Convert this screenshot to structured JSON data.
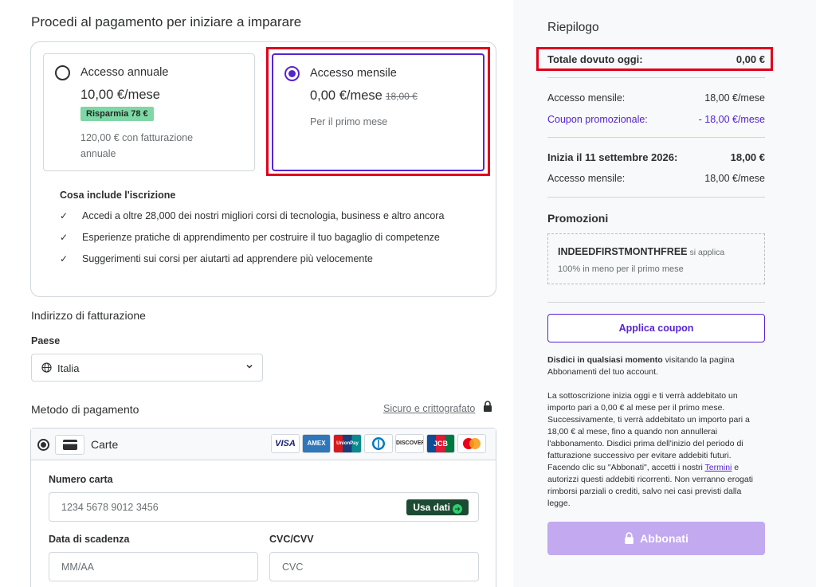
{
  "checkout": {
    "title": "Procedi al pagamento per iniziare a imparare",
    "plans": {
      "annual": {
        "name": "Accesso annuale",
        "price": "10,00 €/mese",
        "badge": "Risparmia 78 €",
        "note": "120,00 € con fatturazione annuale",
        "selected": false
      },
      "monthly": {
        "name": "Accesso mensile",
        "price": "0,00 €/mese",
        "old_price": "18,00 €",
        "note": "Per il primo mese",
        "selected": true
      }
    },
    "includes": {
      "title": "Cosa include l'iscrizione",
      "items": [
        "Accedi a oltre 28,000 dei nostri migliori corsi di tecnologia, business e altro ancora",
        "Esperienze pratiche di apprendimento per costruire il tuo bagaglio di competenze",
        "Suggerimenti sui corsi per aiutarti ad apprendere più velocemente"
      ]
    },
    "billing": {
      "title": "Indirizzo di fatturazione",
      "country_label": "Paese",
      "country_value": "Italia"
    },
    "payment": {
      "title": "Metodo di pagamento",
      "secure_label": "Sicuro e crittografato",
      "method_label": "Carte",
      "brands": [
        "VISA",
        "AMEX",
        "UnionPay",
        "Diners",
        "DISCOVER",
        "JCB",
        "Mastercard"
      ],
      "card_number_label": "Numero carta",
      "card_number_placeholder": "1234 5678 9012 3456",
      "use_data_label": "Usa dati",
      "expiry_label": "Data di scadenza",
      "expiry_placeholder": "MM/AA",
      "cvc_label": "CVC/CVV",
      "cvc_placeholder": "CVC"
    }
  },
  "summary": {
    "title": "Riepilogo",
    "total_label": "Totale dovuto oggi:",
    "total_value": "0,00 €",
    "monthly_label": "Accesso mensile:",
    "monthly_value": "18,00 €/mese",
    "coupon_label": "Coupon promozionale:",
    "coupon_value": "- 18,00 €/mese",
    "starts_label": "Inizia il 11 settembre 2026:",
    "starts_value": "18,00 €",
    "monthly2_label": "Accesso mensile:",
    "monthly2_value": "18,00 €/mese",
    "promotions_title": "Promozioni",
    "promo_code": "INDEEDFIRSTMONTHFREE",
    "promo_applied": "si applica",
    "promo_desc": "100% in meno per il primo mese",
    "apply_coupon": "Applica coupon",
    "cancel_bold": "Disdici in qualsiasi momento",
    "cancel_rest": " visitando la pagina Abbonamenti del tuo account.",
    "legal_part1": "La sottoscrizione inizia oggi e ti verrà addebitato un importo pari a 0,00 € al mese per il primo mese. Successivamente, ti verrà addebitato un importo pari a 18,00 € al mese, fino a quando non annullerai l'abbonamento. Disdici prima dell'inizio del periodo di fatturazione successivo per evitare addebiti futuri. Facendo clic su \"Abbonati\", accetti i nostri ",
    "legal_link": "Termini",
    "legal_part2": " e autorizzi questi addebiti ricorrenti. Non verranno erogati rimborsi parziali o crediti, salvo nei casi previsti dalla legge.",
    "subscribe_label": "Abbonati"
  },
  "colors": {
    "accent": "#5624d0",
    "highlight": "#e0001b",
    "badge": "#7ed7a4",
    "subscribe_disabled": "#c2a9f0"
  }
}
